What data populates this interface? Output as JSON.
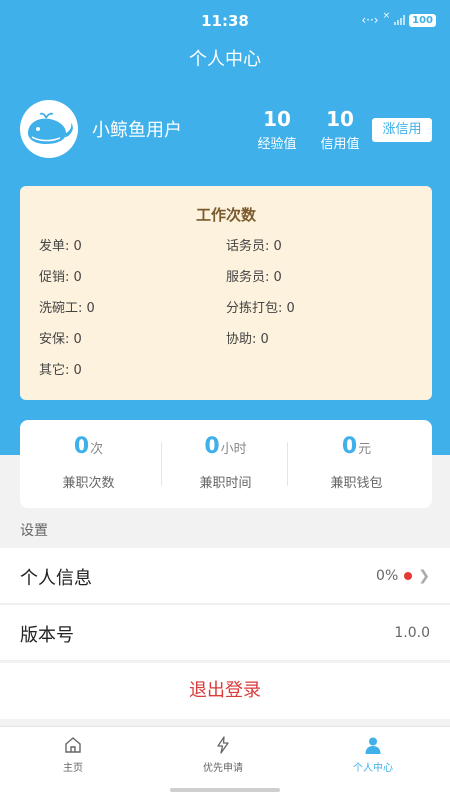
{
  "status_bar": {
    "time": "11:38",
    "battery": "100",
    "signal_x": "×"
  },
  "header": {
    "title": "个人中心"
  },
  "user": {
    "name": "小鲸鱼用户",
    "avatar_icon": "whale-icon"
  },
  "stats": {
    "experience_value": "10",
    "experience_label": "经验值",
    "credit_value": "10",
    "credit_label": "信用值",
    "raise_credit_label": "涨信用"
  },
  "work_counts": {
    "title": "工作次数",
    "items": [
      {
        "label": "发单: 0"
      },
      {
        "label": "话务员: 0"
      },
      {
        "label": "促销: 0"
      },
      {
        "label": "服务员: 0"
      },
      {
        "label": "洗碗工: 0"
      },
      {
        "label": "分拣打包: 0"
      },
      {
        "label": "安保: 0"
      },
      {
        "label": "协助: 0"
      },
      {
        "label": "其它: 0"
      }
    ]
  },
  "part_time": [
    {
      "value": "0",
      "unit": "次",
      "label": "兼职次数"
    },
    {
      "value": "0",
      "unit": "小时",
      "label": "兼职时间"
    },
    {
      "value": "0",
      "unit": "元",
      "label": "兼职钱包"
    }
  ],
  "settings": {
    "section_label": "设置",
    "personal_info_label": "个人信息",
    "personal_info_value": "0%",
    "version_label": "版本号",
    "version_value": "1.0.0",
    "logout_label": "退出登录"
  },
  "tabs": [
    {
      "label": "主页",
      "icon": "home-icon"
    },
    {
      "label": "优先申请",
      "icon": "lightning-icon"
    },
    {
      "label": "个人中心",
      "icon": "person-icon",
      "active": true
    }
  ],
  "colors": {
    "primary": "#3fb0ea",
    "card_bg": "#fdf2dd",
    "logout": "#d93a3a",
    "dot": "#e53935"
  }
}
